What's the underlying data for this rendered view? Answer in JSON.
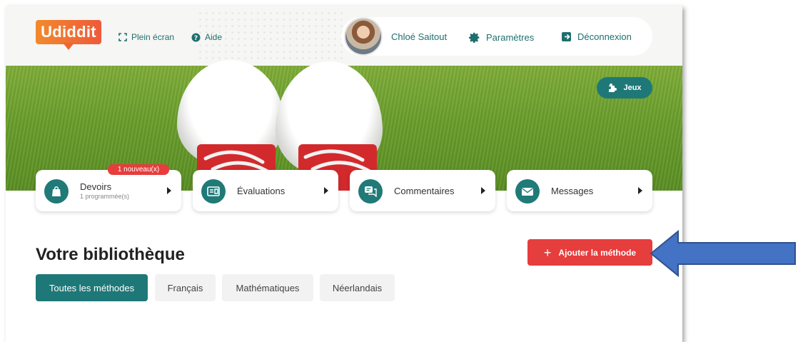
{
  "header": {
    "logo_text": "Udiddit",
    "fullscreen_label": "Plein écran",
    "help_label": "Aide",
    "user_name": "Chloé Saitout",
    "settings_label": "Paramètres",
    "logout_label": "Déconnexion"
  },
  "hero": {
    "games_label": "Jeux"
  },
  "cards": [
    {
      "label": "Devoirs",
      "sub": "1 programmée(s)",
      "badge": "1 nouveau(x)",
      "icon": "bag-icon"
    },
    {
      "label": "Évaluations",
      "icon": "evaluation-icon"
    },
    {
      "label": "Commentaires",
      "icon": "comments-icon"
    },
    {
      "label": "Messages",
      "icon": "mail-icon"
    }
  ],
  "library": {
    "title": "Votre bibliothèque",
    "add_button": "Ajouter la méthode",
    "tabs": [
      "Toutes les méthodes",
      "Français",
      "Mathématiques",
      "Néerlandais"
    ],
    "active_tab": "Toutes les méthodes"
  },
  "colors": {
    "brand_teal": "#1f7878",
    "accent_red": "#e63d3d",
    "logo_orange": "#f28a2c",
    "annotation_arrow": "#4472c4"
  }
}
